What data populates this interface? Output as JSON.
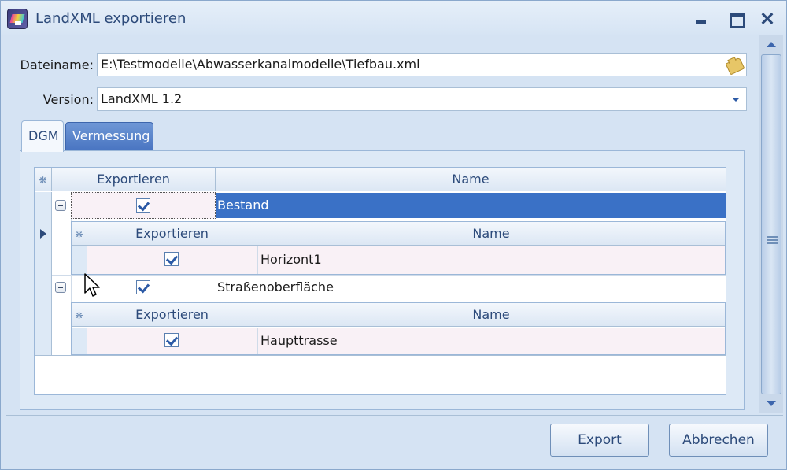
{
  "window": {
    "title": "LandXML exportieren"
  },
  "form": {
    "filename_label": "Dateiname:",
    "filename_value": "E:\\Testmodelle\\Abwasserkanalmodelle\\Tiefbau.xml",
    "version_label": "Version:",
    "version_value": "LandXML 1.2"
  },
  "tabs": [
    {
      "label": "DGM",
      "active": true
    },
    {
      "label": "Vermessung",
      "active": false
    }
  ],
  "grid": {
    "columns": [
      "Exportieren",
      "Name"
    ],
    "rows": [
      {
        "name": "Bestand",
        "exportieren": true,
        "selected": true,
        "expanded": true,
        "detail": {
          "columns": [
            "Exportieren",
            "Name"
          ],
          "rows": [
            {
              "name": "Horizont1",
              "exportieren": true
            }
          ]
        }
      },
      {
        "name": "Straßenoberfläche",
        "exportieren": true,
        "selected": false,
        "expanded": true,
        "detail": {
          "columns": [
            "Exportieren",
            "Name"
          ],
          "rows": [
            {
              "name": "Haupttrasse",
              "exportieren": true
            }
          ]
        }
      }
    ]
  },
  "buttons": {
    "export": "Export",
    "cancel": "Abbrechen"
  },
  "icons": {
    "app": "landxml-app-icon",
    "folder": "folder-browse-icon",
    "dropdown": "chevron-down-icon",
    "expander": "collapse-minus-icon",
    "row_indicator": "row-pointer-icon",
    "header_glyph": "snowflake-icon"
  },
  "colors": {
    "selection": "#3a71c6",
    "accent": "#2c4a7a",
    "row_tint": "#f9f1f6"
  }
}
